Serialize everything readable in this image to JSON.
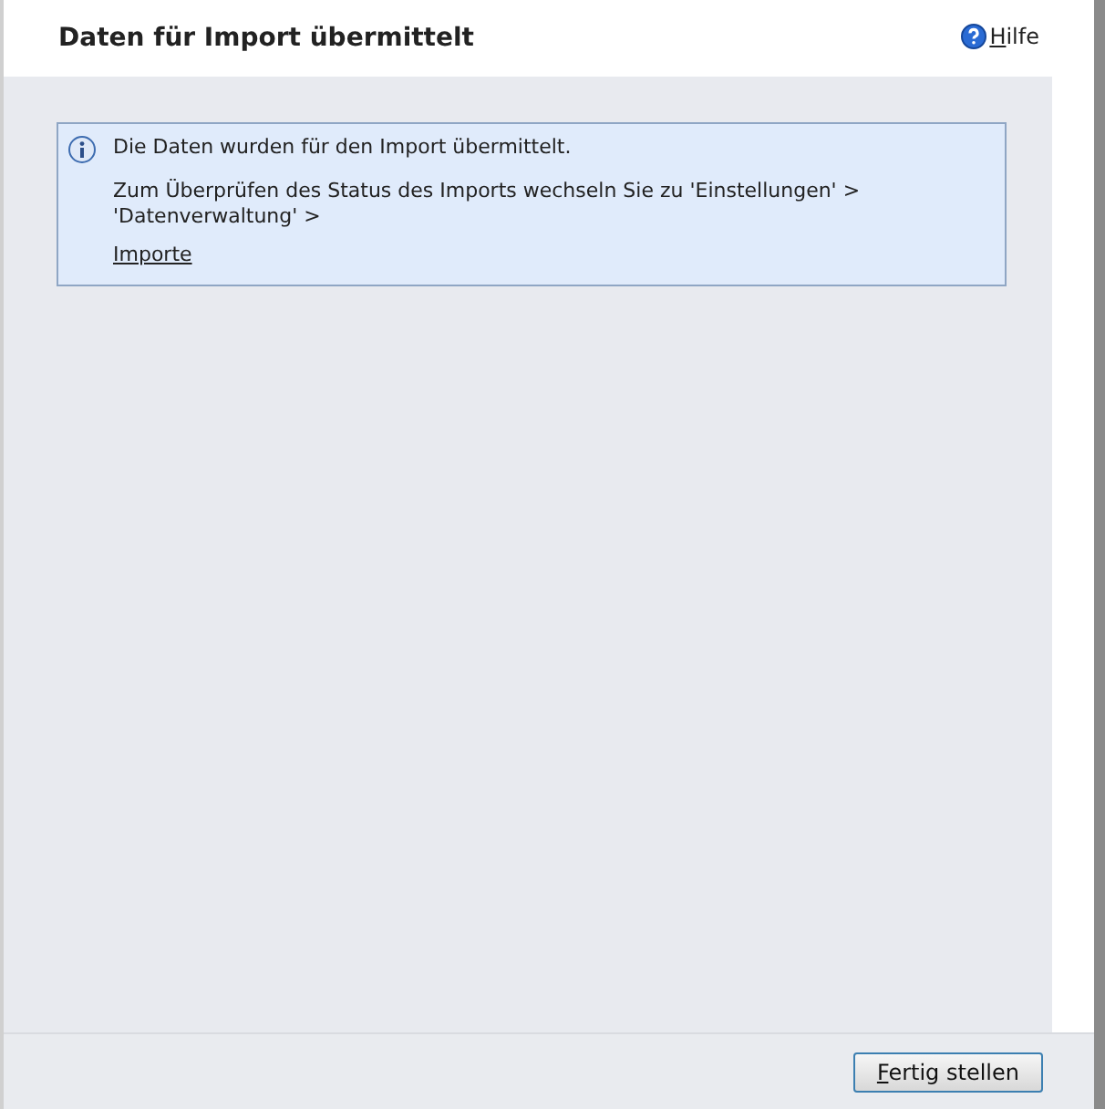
{
  "dialog": {
    "title": "Daten für Import übermittelt",
    "help_link": "Hilfe"
  },
  "info": {
    "message": "Die Daten wurden für den Import übermittelt.",
    "instruction": "Zum Überprüfen des Status des Imports wechseln Sie zu 'Einstellungen' > 'Datenverwaltung' >",
    "link": "Importe"
  },
  "buttons": [
    {
      "label": "Fertig stellen"
    }
  ]
}
